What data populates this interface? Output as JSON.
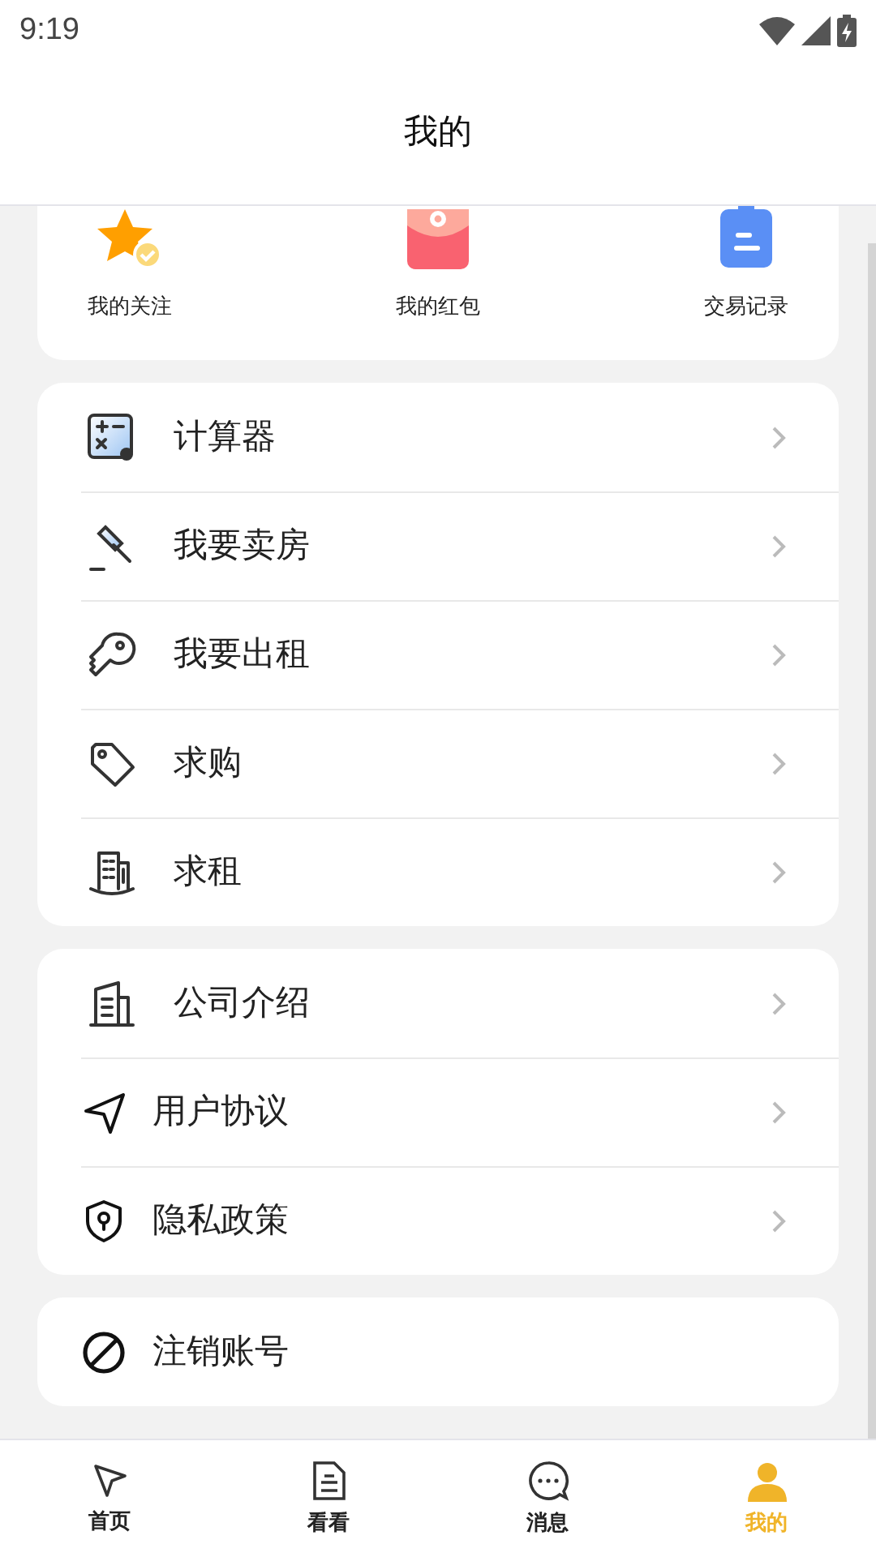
{
  "status_bar": {
    "time": "9:19"
  },
  "header": {
    "title": "我的"
  },
  "shortcuts": [
    {
      "label": "我的关注"
    },
    {
      "label": "我的红包"
    },
    {
      "label": "交易记录"
    }
  ],
  "menu_groups": [
    {
      "items": [
        {
          "label": "计算器"
        },
        {
          "label": "我要卖房"
        },
        {
          "label": "我要出租"
        },
        {
          "label": "求购"
        },
        {
          "label": "求租"
        }
      ]
    },
    {
      "items": [
        {
          "label": "公司介绍"
        },
        {
          "label": "用户协议"
        },
        {
          "label": "隐私政策"
        }
      ]
    },
    {
      "items": [
        {
          "label": "注销账号"
        }
      ]
    }
  ],
  "bottom_nav": [
    {
      "label": "首页",
      "selected": false
    },
    {
      "label": "看看",
      "selected": false
    },
    {
      "label": "消息",
      "selected": false
    },
    {
      "label": "我的",
      "selected": true
    }
  ]
}
